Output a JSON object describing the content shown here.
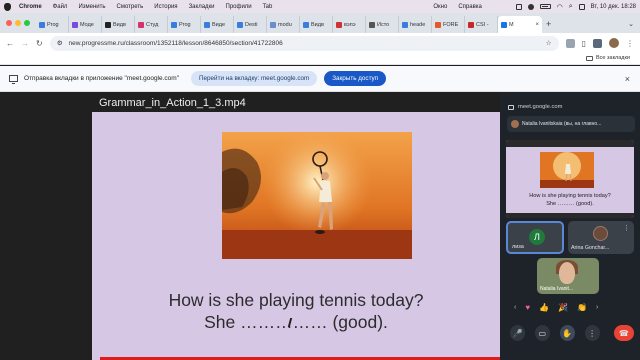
{
  "menubar": {
    "app": "Chrome",
    "items": [
      "Файл",
      "Изменить",
      "Смотреть",
      "История",
      "Закладки",
      "Профили",
      "Tab"
    ],
    "right": [
      "Окно",
      "Справка"
    ],
    "clock": "Вт, 10 дек.  18:28"
  },
  "tabs": [
    {
      "label": "Prog",
      "color": "#3b7ddd"
    },
    {
      "label": "Моде",
      "color": "#7a4bd8"
    },
    {
      "label": "Видв",
      "color": "#222222"
    },
    {
      "label": "Студ",
      "color": "#d6336c"
    },
    {
      "label": "Prog",
      "color": "#3b7ddd"
    },
    {
      "label": "Виде",
      "color": "#3b7ddd"
    },
    {
      "label": "Desti",
      "color": "#3b7ddd"
    },
    {
      "label": "modu",
      "color": "#6a8fcf"
    },
    {
      "label": "Видв",
      "color": "#3b7ddd"
    },
    {
      "label": "вэпэ",
      "color": "#cc3333"
    },
    {
      "label": "Исто",
      "color": "#555555"
    },
    {
      "label": "heade",
      "color": "#3b7ddd"
    },
    {
      "label": "FORE",
      "color": "#e05a2a"
    },
    {
      "label": "CSI -",
      "color": "#c62828"
    },
    {
      "label": "M",
      "color": "#1a73e8",
      "active": true
    }
  ],
  "address": {
    "url": "new.progressme.ru/classroom/1352118/lesson/8646850/section/41722806"
  },
  "bookmarks": {
    "all": "Все закладки"
  },
  "infobar": {
    "text": "Отправка вкладки в приложение \"meet.google.com\"",
    "goto": "Перейти на вкладку: meet.google.com",
    "share": "Закрыть доступ"
  },
  "video": {
    "title": "Grammar_in_Action_1_3.mp4",
    "question": "How is she playing tennis today?",
    "answer": "She …………… (good)."
  },
  "meet": {
    "origin": "meet.google.com",
    "presenter": "Natalia Ivanitskaia (вы, на главно...",
    "mini_question": "How is she playing tennis today?",
    "mini_answer": "She ……… (good).",
    "tile1_letter": "Л",
    "tile1_name": "лиза",
    "tile2_name": "Arina Gonchar...",
    "tile3_name": "Natalia Ivanit..."
  }
}
